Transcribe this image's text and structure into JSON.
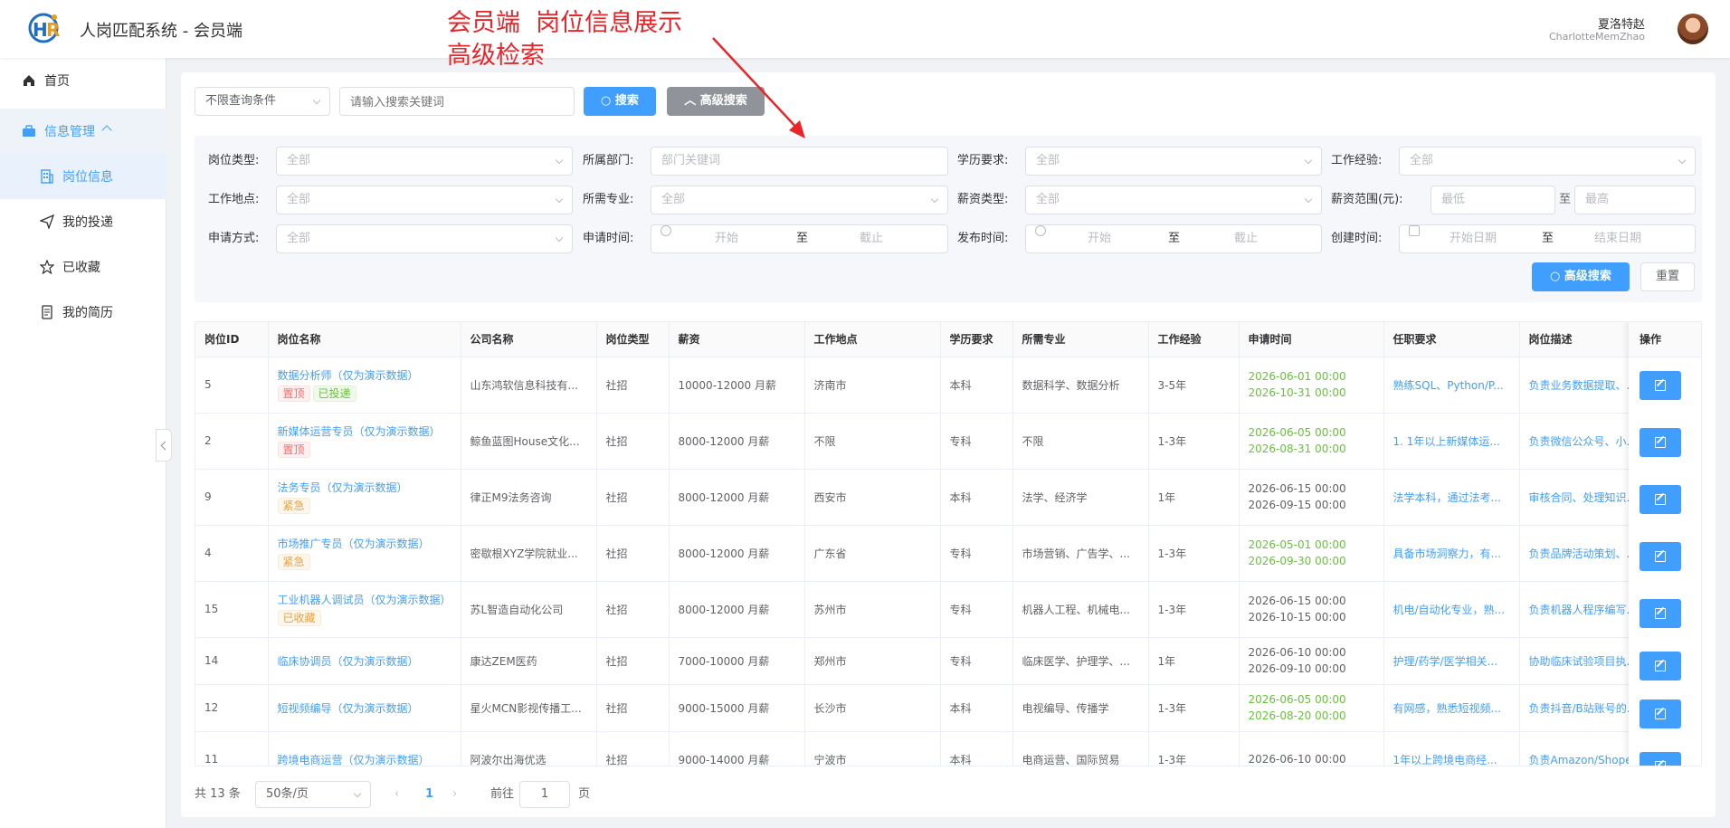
{
  "header": {
    "title": "人岗匹配系统 - 会员端",
    "user_name": "夏洛特赵",
    "user_id": "CharlotteMemZhao"
  },
  "annotation": {
    "line1": "会员端  岗位信息展示",
    "line2": "高级检索"
  },
  "sidebar": {
    "home": "首页",
    "group": "信息管理",
    "items": [
      "岗位信息",
      "我的投递",
      "已收藏",
      "我的简历"
    ]
  },
  "search": {
    "condition": "不限查询条件",
    "keyword_placeholder": "请输入搜索关键词",
    "search_btn": "搜索",
    "advanced_btn": "高级搜索"
  },
  "advanced": {
    "job_type": {
      "label": "岗位类型:",
      "value": "全部"
    },
    "department": {
      "label": "所属部门:",
      "placeholder": "部门关键词"
    },
    "education": {
      "label": "学历要求:",
      "value": "全部"
    },
    "experience": {
      "label": "工作经验:",
      "value": "全部"
    },
    "location": {
      "label": "工作地点:",
      "value": "全部"
    },
    "major": {
      "label": "所需专业:",
      "value": "全部"
    },
    "salary_type": {
      "label": "薪资类型:",
      "value": "全部"
    },
    "salary_range": {
      "label": "薪资范围(元):",
      "min": "最低",
      "to": "至",
      "max": "最高"
    },
    "apply_method": {
      "label": "申请方式:",
      "value": "全部"
    },
    "apply_time": {
      "label": "申请时间:",
      "start": "开始",
      "to": "至",
      "end": "截止"
    },
    "publish_time": {
      "label": "发布时间:",
      "start": "开始",
      "to": "至",
      "end": "截止"
    },
    "create_time": {
      "label": "创建时间:",
      "start": "开始日期",
      "to": "至",
      "end": "结束日期"
    },
    "search_btn": "高级搜索",
    "reset_btn": "重置"
  },
  "table": {
    "columns": [
      "岗位ID",
      "岗位名称",
      "公司名称",
      "岗位类型",
      "薪资",
      "工作地点",
      "学历要求",
      "所需专业",
      "工作经验",
      "申请时间",
      "任职要求",
      "岗位描述"
    ],
    "op_header": "操作",
    "rows": [
      {
        "id": "5",
        "name": "数据分析师（仅为演示数据）",
        "tags": [
          {
            "t": "置顶",
            "c": "red"
          },
          {
            "t": "已投递",
            "c": "green"
          }
        ],
        "company": "山东鸿软信息科技有...",
        "type": "社招",
        "salary": "10000-12000 月薪",
        "location": "济南市",
        "edu": "本科",
        "major": "数据科学、数据分析",
        "exp": "3-5年",
        "t1": "2026-06-01 00:00",
        "t2": "2026-10-31 00:00",
        "green": true,
        "req": "熟练SQL、Python/P...",
        "desc": "负责业务数据提取、..."
      },
      {
        "id": "2",
        "name": "新媒体运营专员（仅为演示数据）",
        "tags": [
          {
            "t": "置顶",
            "c": "red"
          }
        ],
        "company": "鲸鱼蓝图House文化...",
        "type": "社招",
        "salary": "8000-12000 月薪",
        "location": "不限",
        "edu": "专科",
        "major": "不限",
        "exp": "1-3年",
        "t1": "2026-06-05 00:00",
        "t2": "2026-08-31 00:00",
        "green": true,
        "req": "1. 1年以上新媒体运...",
        "desc": "负责微信公众号、小..."
      },
      {
        "id": "9",
        "name": "法务专员（仅为演示数据）",
        "tags": [
          {
            "t": "紧急",
            "c": "orange"
          }
        ],
        "company": "律正M9法务咨询",
        "type": "社招",
        "salary": "8000-12000 月薪",
        "location": "西安市",
        "edu": "本科",
        "major": "法学、经济学",
        "exp": "1年",
        "t1": "2026-06-15 00:00",
        "t2": "2026-09-15 00:00",
        "green": false,
        "req": "法学本科，通过法考...",
        "desc": "审核合同、处理知识..."
      },
      {
        "id": "4",
        "name": "市场推广专员（仅为演示数据）",
        "tags": [
          {
            "t": "紧急",
            "c": "orange"
          }
        ],
        "company": "密歇根XYZ学院就业...",
        "type": "社招",
        "salary": "8000-12000 月薪",
        "location": "广东省",
        "edu": "专科",
        "major": "市场营销、广告学、...",
        "exp": "1-3年",
        "t1": "2026-05-01 00:00",
        "t2": "2026-09-30 00:00",
        "green": true,
        "req": "具备市场洞察力，有...",
        "desc": "负责品牌活动策划、..."
      },
      {
        "id": "15",
        "name": "工业机器人调试员（仅为演示数据）",
        "tags": [
          {
            "t": "已收藏",
            "c": "orange"
          }
        ],
        "company": "苏L智造自动化公司",
        "type": "社招",
        "salary": "8000-12000 月薪",
        "location": "苏州市",
        "edu": "专科",
        "major": "机器人工程、机械电...",
        "exp": "1-3年",
        "t1": "2026-06-15 00:00",
        "t2": "2026-10-15 00:00",
        "green": false,
        "req": "机电/自动化专业，熟...",
        "desc": "负责机器人程序编写..."
      },
      {
        "id": "14",
        "name": "临床协调员（仅为演示数据）",
        "tags": [],
        "company": "康达ZEM医药",
        "type": "社招",
        "salary": "7000-10000 月薪",
        "location": "郑州市",
        "edu": "专科",
        "major": "临床医学、护理学、...",
        "exp": "1年",
        "t1": "2026-06-10 00:00",
        "t2": "2026-09-10 00:00",
        "green": false,
        "req": "护理/药学/医学相关...",
        "desc": "协助临床试验项目执..."
      },
      {
        "id": "12",
        "name": "短视频编导（仅为演示数据）",
        "tags": [],
        "company": "星火MCN影视传播工...",
        "type": "社招",
        "salary": "9000-15000 月薪",
        "location": "长沙市",
        "edu": "本科",
        "major": "电视编导、传播学",
        "exp": "1-3年",
        "t1": "2026-06-05 00:00",
        "t2": "2026-08-20 00:00",
        "green": true,
        "req": "有网感，熟悉短视频...",
        "desc": "负责抖音/B站账号的..."
      },
      {
        "id": "11",
        "name": "跨境电商运营（仅为演示数据）",
        "tags": [],
        "company": "阿波尔出海优选",
        "type": "社招",
        "salary": "9000-14000 月薪",
        "location": "宁波市",
        "edu": "本科",
        "major": "电商运营、国际贸易",
        "exp": "1-3年",
        "t1": "2026-06-10 00:00",
        "t2": "",
        "green": false,
        "req": "1年以上跨境电商经...",
        "desc": "负责Amazon/Shope..."
      }
    ]
  },
  "pagination": {
    "total": "共 13 条",
    "page_size": "50条/页",
    "current": "1",
    "goto_prefix": "前往",
    "goto_value": "1",
    "goto_suffix": "页"
  }
}
